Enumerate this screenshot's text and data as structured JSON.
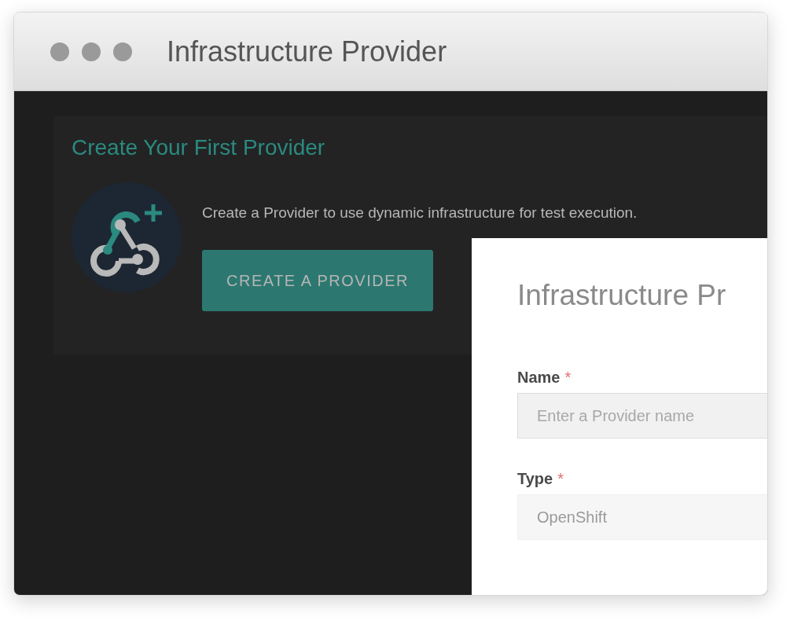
{
  "window": {
    "title": "Infrastructure Provider"
  },
  "card": {
    "heading": "Create Your First Provider",
    "description": "Create a Provider to use dynamic infrastructure for test execution.",
    "button": "CREATE A PROVIDER"
  },
  "panel": {
    "title": "Infrastructure Pr",
    "fields": [
      {
        "label": "Name",
        "marker": "*",
        "placeholder": "Enter a Provider name",
        "disabled": false
      },
      {
        "label": "Type",
        "marker": "*",
        "value": "OpenShift",
        "disabled": true
      }
    ]
  }
}
